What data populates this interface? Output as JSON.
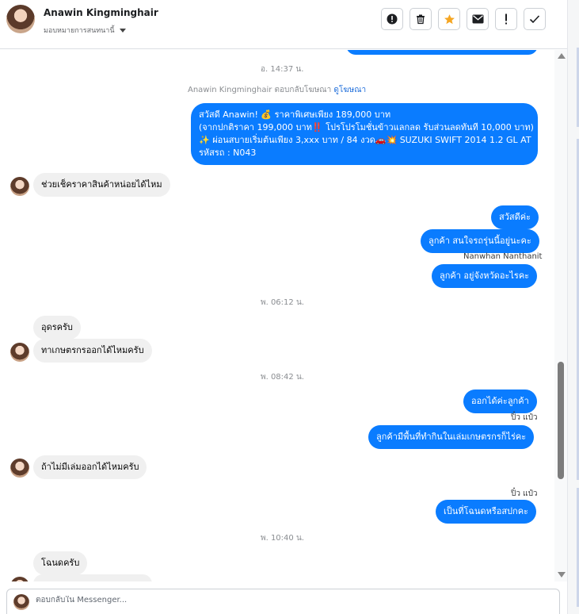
{
  "header": {
    "contact_name": "Anawin Kingminghair",
    "assign_label": "มอบหมายการสนทนานี้",
    "actions": [
      {
        "icon": "alert-circle-icon"
      },
      {
        "icon": "trash-icon"
      },
      {
        "icon": "star-icon",
        "color": "#f5a623"
      },
      {
        "icon": "envelope-icon"
      },
      {
        "icon": "exclamation-icon"
      },
      {
        "icon": "checkmark-icon"
      }
    ]
  },
  "thread": {
    "ts1": "อ. 14:37 น.",
    "ad_reply": {
      "text": "Anawin Kingminghair ตอบกลับโฆษณา",
      "link": "ดูโฆษณา"
    },
    "ad_lines": [
      "สวัสดี Anawin! 💰 ราคาพิเศษเพียง 189,000 บาท",
      "(จากปกติราคา 199,000 บาท‼️ โปรโปรโมชั่นข้าวแลกลด รับส่วนลดทันที 10,000 บาท)",
      "✨ ผ่อนสบายเริ่มต้นเพียง 3,xxx บาท / 84 งวด🚗💥 SUZUKI SWIFT 2014 1.2 GL AT",
      "รหัสรถ : N043"
    ],
    "in1": "ช่วยเช็คราคาสินค้าหน่อยได้ไหม",
    "out2": "สวัสดีค่ะ",
    "out3": "ลูกค้า สนใจรถรุ่นนี้อยู่นะคะ",
    "sender1": "Nanwhan Nanthanit",
    "out4": "ลูกค้า อยู่จังหวัดอะไรคะ",
    "ts2": "พ. 06:12 น.",
    "in2": "อุดรครับ",
    "in3": "ทาเกษตรกรออกได้ไหมครับ",
    "ts3": "พ. 08:42 น.",
    "out5": "ออกได้ค่ะลูกค้า",
    "sender2": "ปิ๋ว แป๋ว",
    "out6": "ลูกค้ามีพื้นที่ทำกินในเล่มเกษตรกรก็ไร่คะ",
    "in4": "ถ้าไม่มีเล่มออกได้ไหมครับ",
    "sender3": "ปิ๋ว แป๋ว",
    "out7": "เป็นที่โฉนดหรือสปกคะ",
    "ts4": "พ. 10:40 น.",
    "in5": "โฉนดครับ"
  },
  "composer": {
    "placeholder": "ตอบกลับใน Messenger..."
  },
  "colors": {
    "outgoing_bubble": "#0a7cff",
    "incoming_bubble": "#f0f0f0",
    "link": "#216fdb"
  }
}
